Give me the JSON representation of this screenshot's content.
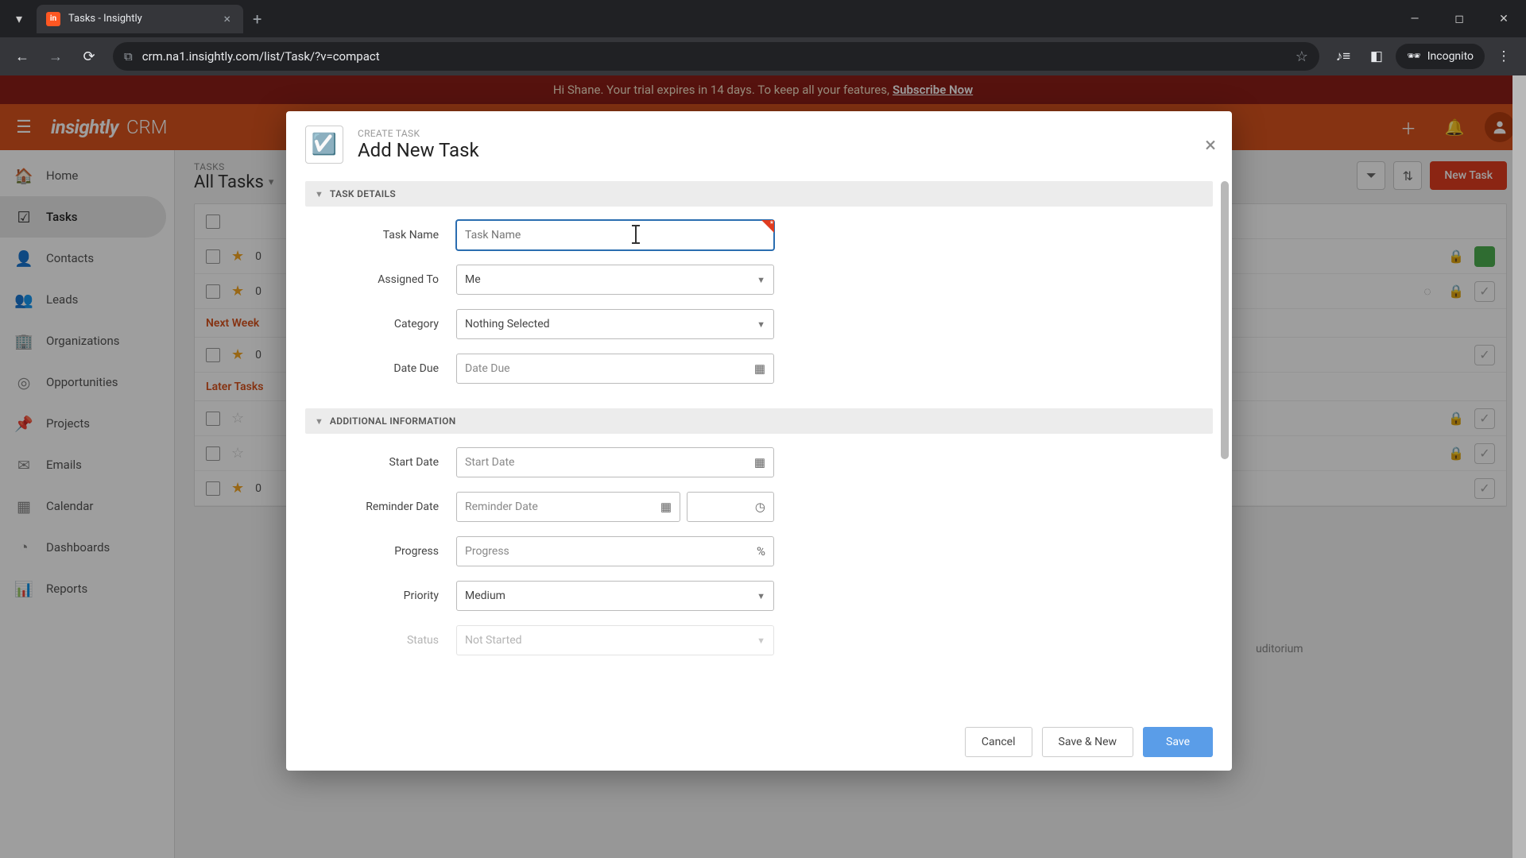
{
  "browser": {
    "tab_title": "Tasks - Insightly",
    "url": "crm.na1.insightly.com/list/Task/?v=compact",
    "incognito_label": "Incognito"
  },
  "trial_banner": {
    "greeting": "Hi Shane. Your trial expires in 14 days. To keep all your features, ",
    "cta": "Subscribe Now"
  },
  "header": {
    "brand": "insightly",
    "product": "CRM"
  },
  "sidebar": {
    "items": [
      {
        "label": "Home"
      },
      {
        "label": "Tasks"
      },
      {
        "label": "Contacts"
      },
      {
        "label": "Leads"
      },
      {
        "label": "Organizations"
      },
      {
        "label": "Opportunities"
      },
      {
        "label": "Projects"
      },
      {
        "label": "Emails"
      },
      {
        "label": "Calendar"
      },
      {
        "label": "Dashboards"
      },
      {
        "label": "Reports"
      }
    ]
  },
  "main": {
    "eyebrow": "TASKS",
    "title": "All Tasks",
    "new_task_label": "New Task",
    "sections": {
      "next_week": "Next Week",
      "later": "Later Tasks"
    },
    "row_text_prefix": "0",
    "loose_text": "uditorium"
  },
  "modal": {
    "eyebrow": "CREATE TASK",
    "title": "Add New Task",
    "sections": {
      "details": "TASK DETAILS",
      "additional": "ADDITIONAL INFORMATION"
    },
    "fields": {
      "task_name": {
        "label": "Task Name",
        "placeholder": "Task Name",
        "value": ""
      },
      "assigned_to": {
        "label": "Assigned To",
        "value": "Me"
      },
      "category": {
        "label": "Category",
        "value": "Nothing Selected"
      },
      "date_due": {
        "label": "Date Due",
        "placeholder": "Date Due"
      },
      "start_date": {
        "label": "Start Date",
        "placeholder": "Start Date"
      },
      "reminder_date": {
        "label": "Reminder Date",
        "placeholder": "Reminder Date"
      },
      "progress": {
        "label": "Progress",
        "placeholder": "Progress"
      },
      "priority": {
        "label": "Priority",
        "value": "Medium"
      },
      "status": {
        "label": "Status",
        "value": "Not Started"
      }
    },
    "buttons": {
      "cancel": "Cancel",
      "save_new": "Save & New",
      "save": "Save"
    }
  }
}
